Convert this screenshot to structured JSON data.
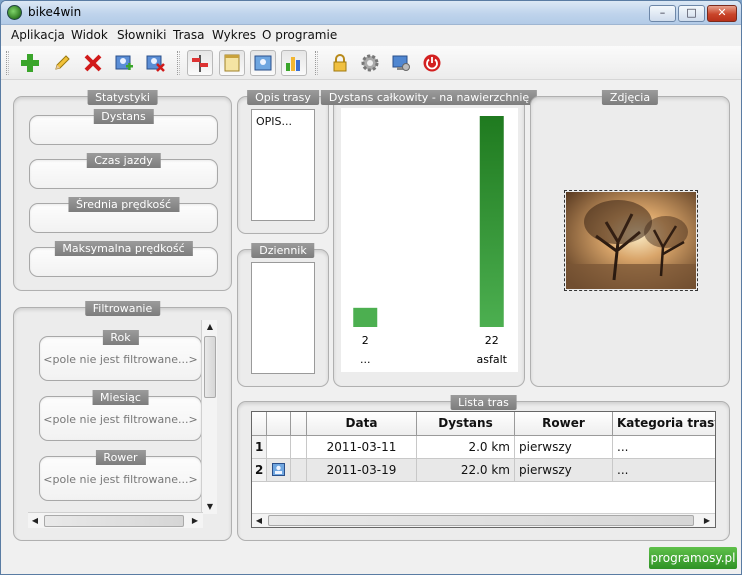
{
  "window": {
    "title": "bike4win"
  },
  "menu": [
    "Aplikacja",
    "Widok",
    "Słowniki",
    "Trasa",
    "Wykres",
    "O programie"
  ],
  "toolbar": {
    "icons": [
      "add-icon",
      "edit-icon",
      "delete-icon",
      "add-user-icon",
      "remove-user-icon",
      "route-signpost-icon",
      "notes-icon",
      "photo-icon",
      "chart-icon",
      "lock-icon",
      "settings-gear-icon",
      "network-icon",
      "power-icon"
    ],
    "pressed": [
      "route-signpost-icon",
      "notes-icon",
      "photo-icon",
      "chart-icon"
    ]
  },
  "statystyki": {
    "title": "Statystyki",
    "fields": [
      {
        "label": "Dystans",
        "value": ""
      },
      {
        "label": "Czas jazdy",
        "value": ""
      },
      {
        "label": "Średnia prędkość",
        "value": ""
      },
      {
        "label": "Maksymalna prędkość",
        "value": ""
      }
    ]
  },
  "filtrowanie": {
    "title": "Filtrowanie",
    "fields": [
      {
        "label": "Rok",
        "value": "<pole nie jest filtrowane...>"
      },
      {
        "label": "Miesiąc",
        "value": "<pole nie jest filtrowane...>"
      },
      {
        "label": "Rower",
        "value": "<pole nie jest filtrowane...>"
      }
    ]
  },
  "opis": {
    "title": "Opis trasy",
    "text": "OPIS..."
  },
  "dziennik": {
    "title": "Dziennik"
  },
  "dystans_chart": {
    "title": "Dystans całkowity - na nawierzchnię"
  },
  "chart_data": {
    "type": "bar",
    "title": "Dystans całkowity - na nawierzchnię",
    "categories": [
      "...",
      "asfalt"
    ],
    "values": [
      2,
      22
    ],
    "ylim": [
      0,
      22
    ],
    "colors": [
      "#4caf50",
      "#1f7a1f"
    ],
    "grid": false,
    "legend": "none"
  },
  "zdjecia": {
    "title": "Zdjęcia"
  },
  "lista": {
    "title": "Lista tras",
    "columns": [
      "Data",
      "Dystans",
      "Rower",
      "Kategoria trasy"
    ],
    "rows": [
      {
        "num": "1",
        "has_photo": false,
        "data": "2011-03-11",
        "dystans": "2.0 km",
        "rower": "pierwszy",
        "kategoria": "..."
      },
      {
        "num": "2",
        "has_photo": true,
        "data": "2011-03-19",
        "dystans": "22.0 km",
        "rower": "pierwszy",
        "kategoria": "..."
      }
    ]
  },
  "watermark": "programosy.pl"
}
